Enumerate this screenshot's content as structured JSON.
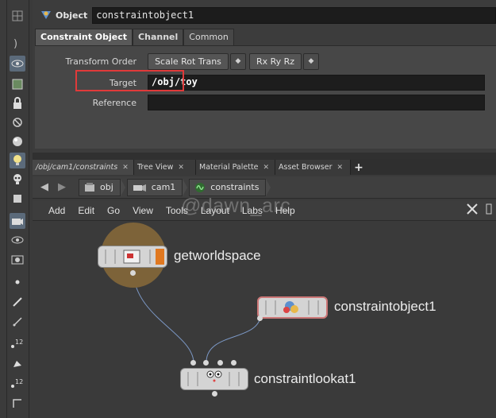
{
  "param_pane": {
    "node_type": "Object",
    "node_name": "constraintobject1",
    "tabs": [
      "Constraint Object",
      "Channel",
      "Common"
    ],
    "transform_order_label": "Transform Order",
    "transform_order_value": "Scale Rot Trans",
    "rotate_order_value": "Rx Ry Rz",
    "target_label": "Target",
    "target_value": "/obj/toy",
    "reference_label": "Reference",
    "reference_value": ""
  },
  "pane_tabs": [
    {
      "label": "/obj/cam1/constraints"
    },
    {
      "label": "Tree View"
    },
    {
      "label": "Material Palette"
    },
    {
      "label": "Asset Browser"
    }
  ],
  "path": {
    "items": [
      "obj",
      "cam1",
      "constraints"
    ]
  },
  "menu": {
    "items": [
      "Add",
      "Edit",
      "Go",
      "View",
      "Tools",
      "Layout",
      "Labs",
      "Help"
    ]
  },
  "watermark": "@dawn_arc",
  "nodes": {
    "getworldspace": "getworldspace",
    "constraintobject": "constraintobject1",
    "constraintlookat": "constraintlookat1"
  },
  "colors": {
    "highlight_box": "#e03a3a",
    "node_flag_orange": "#e07820",
    "selected_node_halo": "#7d6339"
  }
}
